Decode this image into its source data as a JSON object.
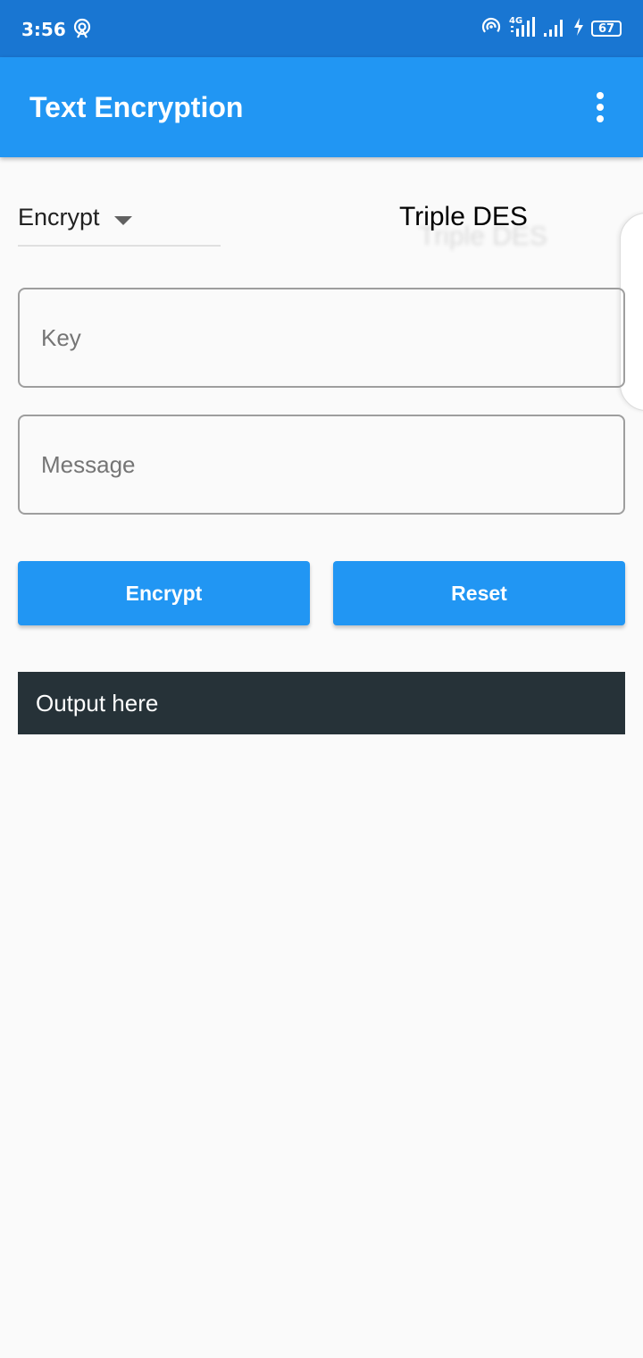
{
  "status_bar": {
    "time": "3:56",
    "network": "4G",
    "battery": "67",
    "icons": [
      "hotspot-icon",
      "wireless-icon",
      "signal-4g-icon",
      "signal-icon",
      "charging-icon",
      "battery-icon"
    ]
  },
  "app_bar": {
    "title": "Text Encryption",
    "menu_icon": "more-vert-icon"
  },
  "mode_dropdown": {
    "selected": "Encrypt",
    "icon": "arrow-drop-down-icon"
  },
  "algorithm": {
    "label": "Triple DES"
  },
  "key_field": {
    "placeholder": "Key",
    "value": ""
  },
  "message_field": {
    "placeholder": "Message",
    "value": ""
  },
  "buttons": {
    "encrypt_label": "Encrypt",
    "reset_label": "Reset"
  },
  "output": {
    "text": "Output here"
  },
  "colors": {
    "status_bar": "#1976d2",
    "app_bar": "#2196f3",
    "button": "#2196f3",
    "output_bg": "#263238",
    "background": "#fafafa"
  }
}
